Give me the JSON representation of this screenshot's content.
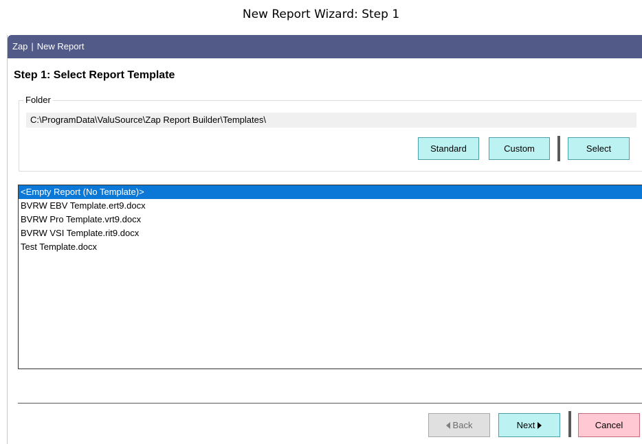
{
  "caption": "New Report Wizard: Step 1",
  "window": {
    "app_name": "Zap",
    "separator": "|",
    "title": "New Report"
  },
  "step": {
    "title": "Step 1:  Select Report Template"
  },
  "folder": {
    "legend": "Folder",
    "path": "C:\\ProgramData\\ValuSource\\Zap Report Builder\\Templates\\",
    "buttons": {
      "standard": "Standard",
      "custom": "Custom",
      "select": "Select"
    }
  },
  "templates": {
    "items": [
      "<Empty Report (No Template)>",
      "BVRW EBV Template.ert9.docx",
      "BVRW Pro Template.vrt9.docx",
      "BVRW VSI Template.rit9.docx",
      "Test Template.docx"
    ],
    "selected_index": 0
  },
  "footer": {
    "back": "Back",
    "next": "Next",
    "cancel": "Cancel"
  },
  "colors": {
    "titlebar": "#525a87",
    "accent_button": "#bcf2f2",
    "cancel_button": "#ffc8d2",
    "selection": "#0b78d7"
  }
}
